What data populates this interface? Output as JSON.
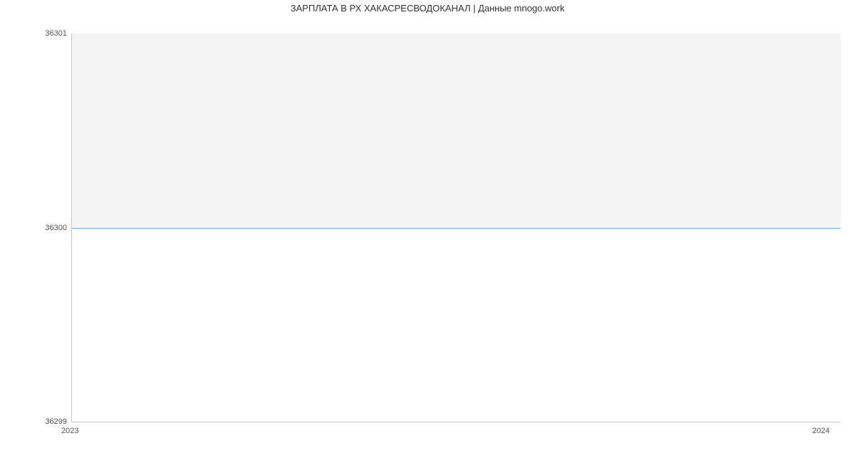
{
  "chart_data": {
    "type": "line",
    "title": "ЗАРПЛАТА В РХ ХАКАСРЕСВОДОКАНАЛ | Данные mnogo.work",
    "xlabel": "",
    "ylabel": "",
    "categories": [
      "2023",
      "2024"
    ],
    "values": [
      36300,
      36300
    ],
    "ylim": [
      36299,
      36301
    ],
    "yticks": [
      "36299",
      "36300",
      "36301"
    ],
    "xticks": [
      "2023",
      "2024"
    ],
    "fill": "above",
    "line_color": "#6fa8ff",
    "fill_color": "#f4f4f4"
  }
}
